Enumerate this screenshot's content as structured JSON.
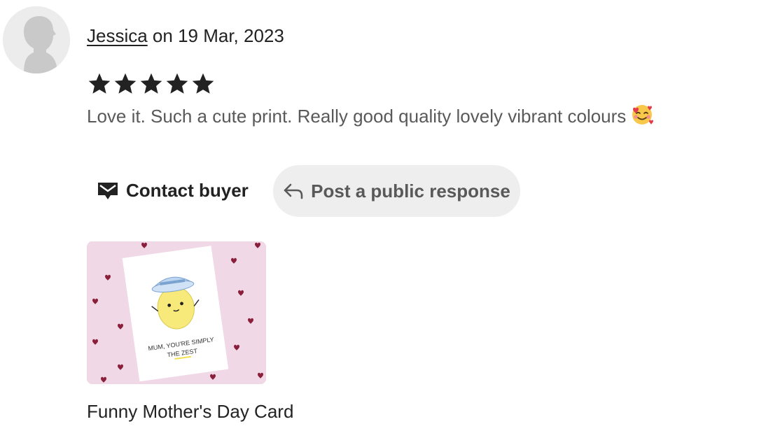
{
  "review": {
    "reviewer_name": "Jessica",
    "date_text": " on 19 Mar, 2023",
    "rating": 5,
    "max_rating": 5,
    "text": "Love it. Such a cute print. Really good quality lovely vibrant colours",
    "emoji_icon": "smiling-face-with-hearts-icon"
  },
  "actions": {
    "contact_label": "Contact buyer",
    "contact_icon": "envelope-icon",
    "response_label": "Post a public response",
    "response_icon": "reply-arrow-icon"
  },
  "product": {
    "title": "Funny Mother's Day Card",
    "card_text_line1": "MUM, YOU'RE SIMPLY",
    "card_text_line2": "THE ZEST"
  },
  "colors": {
    "text": "#222222",
    "muted_text": "#595959",
    "button_bg": "#eeeeee",
    "thumb_bg": "#f0d8e6",
    "star": "#222222"
  }
}
